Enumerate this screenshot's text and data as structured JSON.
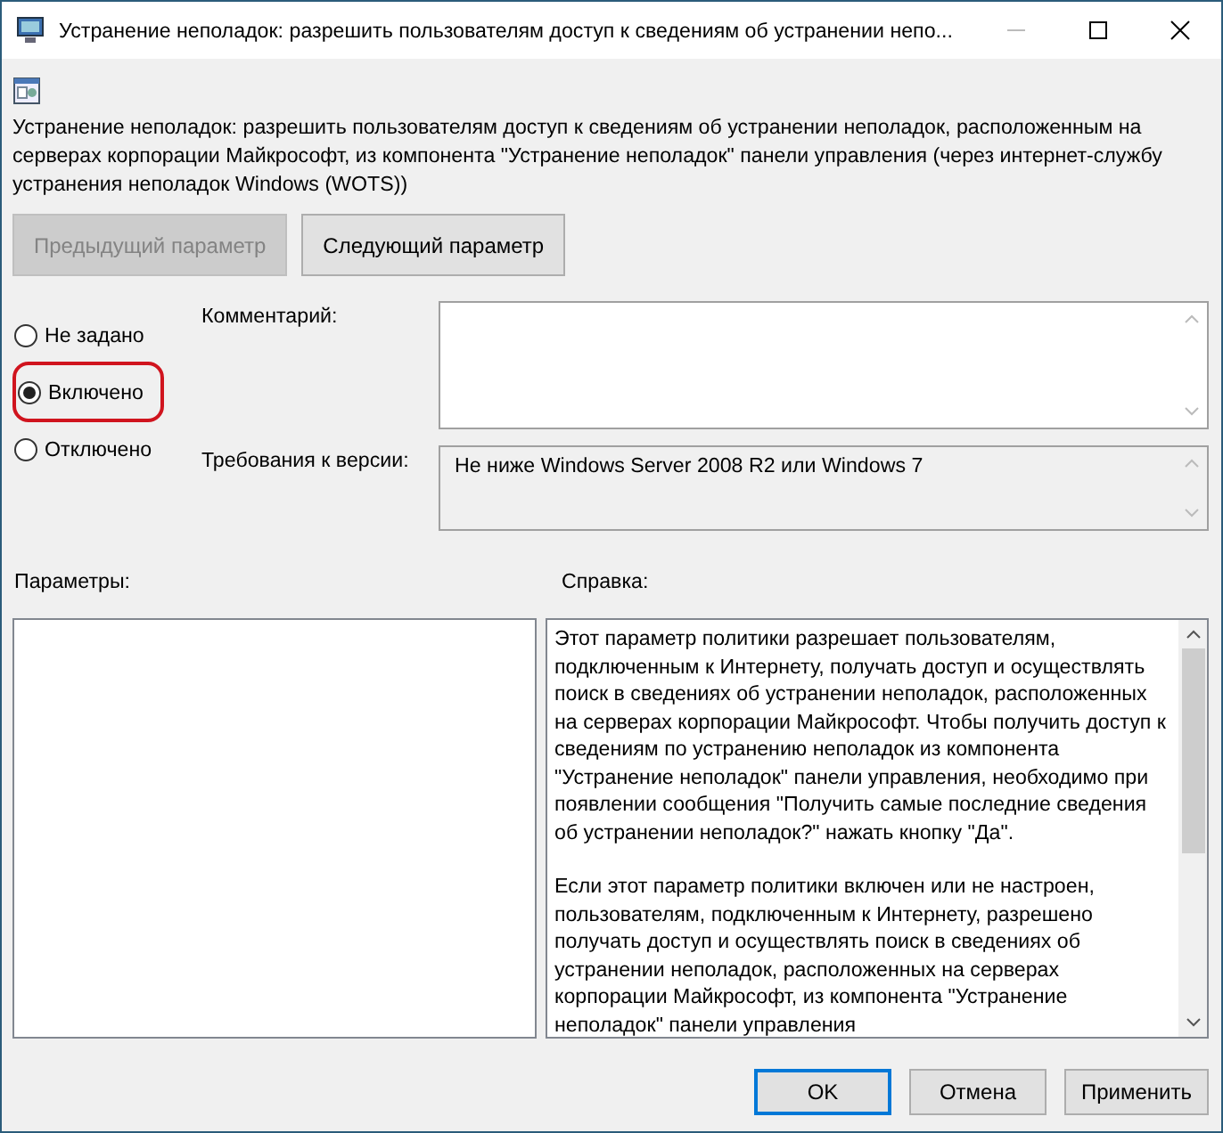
{
  "window": {
    "title": "Устранение неполадок: разрешить пользователям доступ к сведениям об устранении непо..."
  },
  "description": "Устранение неполадок: разрешить пользователям доступ к сведениям об устранении неполадок, расположенным на серверах корпорации Майкрософт, из компонента \"Устранение неполадок\" панели управления (через интернет-службу устранения неполадок Windows (WOTS))",
  "nav_buttons": [
    {
      "label": "Предыдущий параметр",
      "disabled": true
    },
    {
      "label": "Следующий параметр",
      "disabled": false
    }
  ],
  "options": [
    {
      "label": "Не задано",
      "selected": false,
      "highlighted": false
    },
    {
      "label": "Включено",
      "selected": true,
      "highlighted": true
    },
    {
      "label": "Отключено",
      "selected": false,
      "highlighted": false
    }
  ],
  "comment": {
    "label": "Комментарий:"
  },
  "version": {
    "label": "Требования к версии:",
    "value": "Не ниже Windows Server 2008 R2 или Windows 7"
  },
  "parameters": {
    "label": "Параметры:"
  },
  "help": {
    "label": "Справка:",
    "paragraphs": [
      "Этот параметр политики разрешает пользователям, подключенным к Интернету, получать доступ и осуществлять поиск в сведениях об устранении неполадок, расположенных на серверах корпорации Майкрософт. Чтобы получить доступ к сведениям по устранению неполадок из компонента \"Устранение неполадок\" панели управления, необходимо при появлении сообщения \"Получить самые последние сведения об устранении неполадок?\" нажать кнопку \"Да\".",
      "Если этот параметр политики включен или не настроен, пользователям, подключенным к Интернету, разрешено получать доступ и осуществлять поиск в сведениях об устранении неполадок, расположенных на серверах корпорации Майкрософт, из компонента \"Устранение неполадок\" панели управления"
    ]
  },
  "buttons": [
    {
      "label": "OK",
      "default": true
    },
    {
      "label": "Отмена",
      "default": false
    },
    {
      "label": "Применить",
      "default": false
    }
  ]
}
